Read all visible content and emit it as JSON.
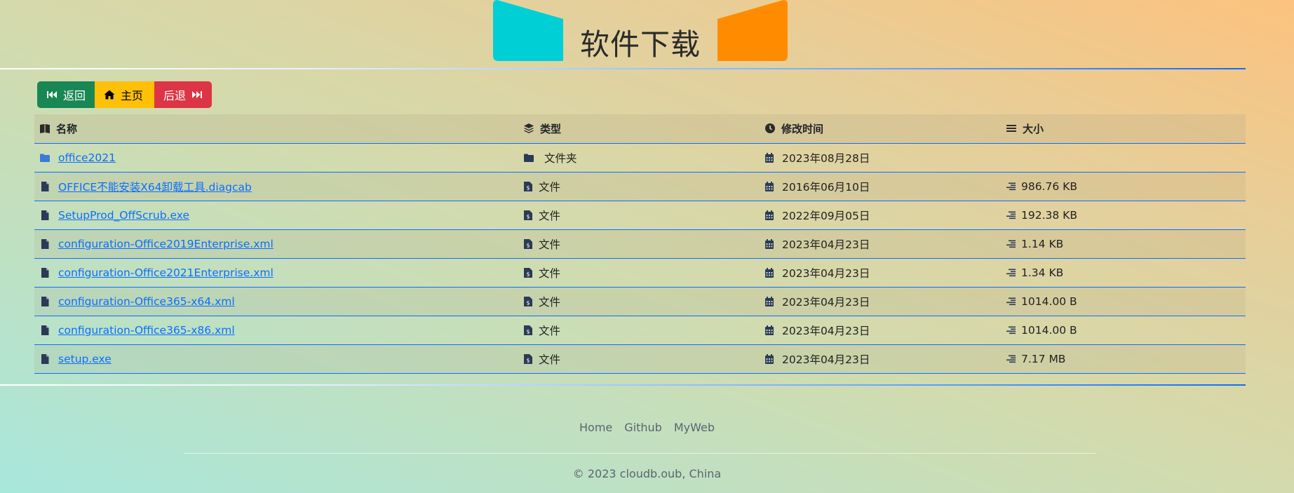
{
  "header": {
    "title": "软件下载",
    "deco_left_color": "#00cfd5",
    "deco_right_color": "#ff8c00"
  },
  "buttons": {
    "back": "返回",
    "home": "主页",
    "forward": "后退",
    "back_color": "#198754",
    "home_color": "#ffc107",
    "forward_color": "#dc3545"
  },
  "table": {
    "headers": {
      "name": "名称",
      "type": "类型",
      "time": "修改时间",
      "size": "大小"
    },
    "rows": [
      {
        "name": "office2021",
        "type": "文件夹",
        "time": "2023年08月28日",
        "size": "",
        "kind": "folder"
      },
      {
        "name": "OFFICE不能安装X64卸载工具.diagcab",
        "type": "文件",
        "time": "2016年06月10日",
        "size": "986.76 KB",
        "kind": "file"
      },
      {
        "name": "SetupProd_OffScrub.exe",
        "type": "文件",
        "time": "2022年09月05日",
        "size": "192.38 KB",
        "kind": "file"
      },
      {
        "name": "configuration-Office2019Enterprise.xml",
        "type": "文件",
        "time": "2023年04月23日",
        "size": "1.14 KB",
        "kind": "file"
      },
      {
        "name": "configuration-Office2021Enterprise.xml",
        "type": "文件",
        "time": "2023年04月23日",
        "size": "1.34 KB",
        "kind": "file"
      },
      {
        "name": "configuration-Office365-x64.xml",
        "type": "文件",
        "time": "2023年04月23日",
        "size": "1014.00 B",
        "kind": "file"
      },
      {
        "name": "configuration-Office365-x86.xml",
        "type": "文件",
        "time": "2023年04月23日",
        "size": "1014.00 B",
        "kind": "file"
      },
      {
        "name": "setup.exe",
        "type": "文件",
        "time": "2023年04月23日",
        "size": "7.17 MB",
        "kind": "file"
      }
    ]
  },
  "footer": {
    "links": [
      "Home",
      "Github",
      "MyWeb"
    ],
    "copyright": "© 2023 cloudb.oub, China"
  },
  "colors": {
    "link": "#0d6efd",
    "icon": "#2b3a55",
    "folder_icon": "#3a7bd5"
  }
}
